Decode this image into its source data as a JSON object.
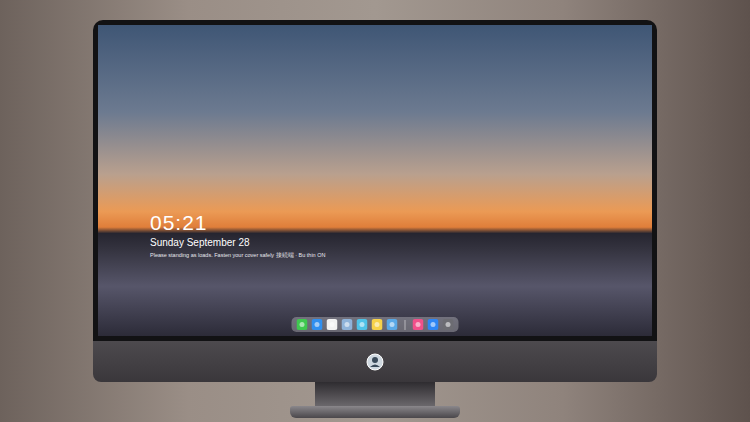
{
  "lock_screen": {
    "time": "05:21",
    "date": "Sunday September 28",
    "notice": "Please standing as loads. Fasten your cover safely 接続端 · Bu thin ON"
  },
  "dock": {
    "apps": [
      {
        "color": "#3fc84f"
      },
      {
        "color": "#2f8ff0"
      },
      {
        "color": "#f2f2f2"
      },
      {
        "color": "#8fb3d9"
      },
      {
        "color": "#4fc3e8"
      },
      {
        "color": "#f7d24a"
      },
      {
        "color": "#5aa9e6"
      }
    ],
    "extras": [
      {
        "color": "#f0508a"
      },
      {
        "color": "#2e86f5"
      },
      {
        "color": "#6c6c72"
      }
    ]
  }
}
